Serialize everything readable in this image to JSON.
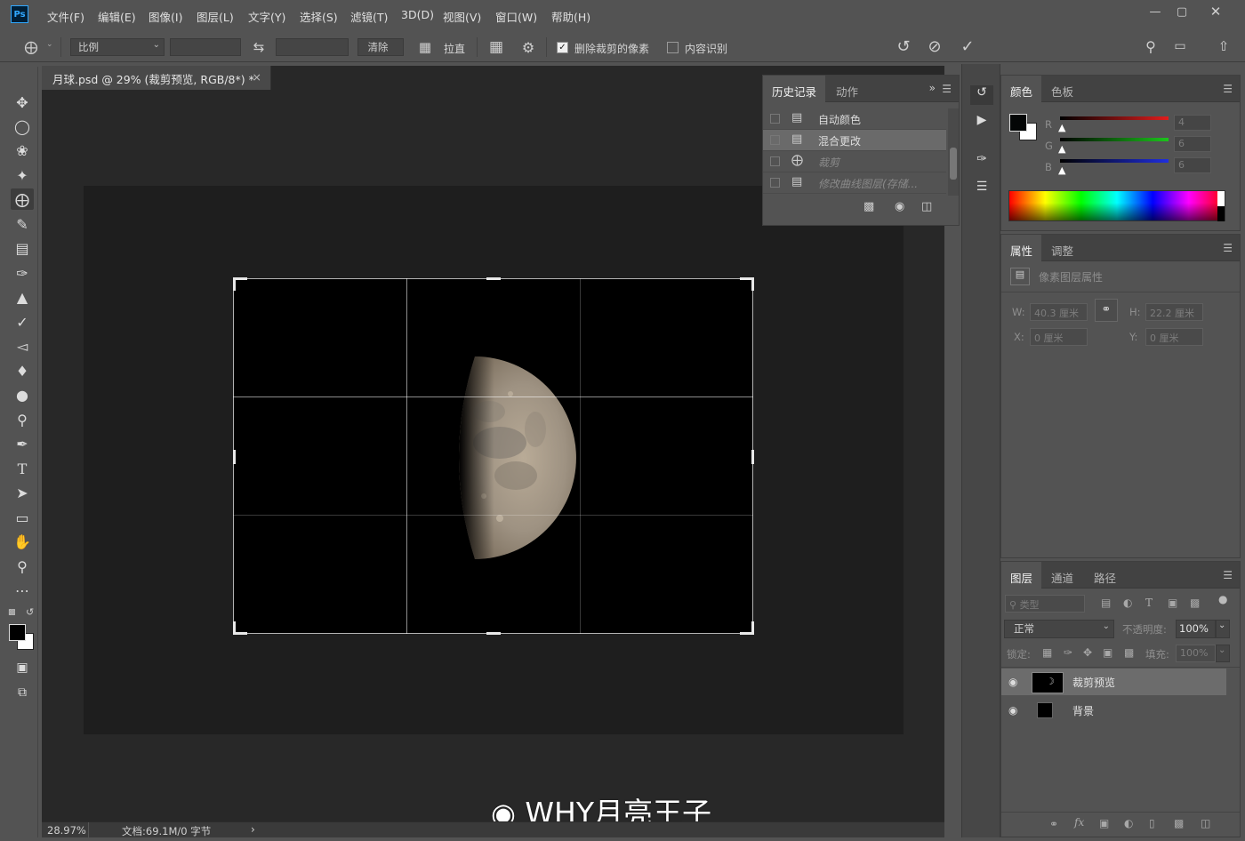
{
  "app": {
    "logo": "Ps"
  },
  "menu": [
    "文件(F)",
    "编辑(E)",
    "图像(I)",
    "图层(L)",
    "文字(Y)",
    "选择(S)",
    "滤镜(T)",
    "3D(D)",
    "视图(V)",
    "窗口(W)",
    "帮助(H)"
  ],
  "window_controls": [
    "minimize-icon",
    "maximize-icon",
    "close-icon"
  ],
  "options": {
    "ratio_label": "比例",
    "clear_label": "清除",
    "straighten_label": "拉直",
    "delete_cropped_label": "删除裁剪的像素",
    "delete_cropped_checked": true,
    "content_aware_label": "内容识别",
    "content_aware_checked": false
  },
  "document": {
    "tab_title": "月球.psd @ 29% (裁剪预览, RGB/8*) *",
    "zoom": "28.97%",
    "doc_info": "文档:69.1M/0 字节"
  },
  "history": {
    "tabs": [
      "历史记录",
      "动作"
    ],
    "items": [
      {
        "label": "自动颜色",
        "icon": "document-icon",
        "selected": false,
        "dimmed": false
      },
      {
        "label": "混合更改",
        "icon": "document-icon",
        "selected": true,
        "dimmed": false
      },
      {
        "label": "裁剪",
        "icon": "crop-icon",
        "selected": false,
        "dimmed": true
      },
      {
        "label": "修改曲线图层(存储...",
        "icon": "document-icon",
        "selected": false,
        "dimmed": true
      }
    ]
  },
  "color_panel": {
    "tabs": [
      "颜色",
      "色板"
    ],
    "channels": [
      {
        "label": "R",
        "value": "4",
        "color": "#e11d1d"
      },
      {
        "label": "G",
        "value": "6",
        "color": "#1cc41c"
      },
      {
        "label": "B",
        "value": "6",
        "color": "#1f2ee0"
      }
    ],
    "foreground": "#040606",
    "background": "#ffffff"
  },
  "properties": {
    "tabs": [
      "属性",
      "调整"
    ],
    "title": "像素图层属性",
    "w_label": "W:",
    "w_value": "40.3 厘米",
    "h_label": "H:",
    "h_value": "22.2 厘米",
    "x_label": "X:",
    "x_value": "0 厘米",
    "y_label": "Y:",
    "y_value": "0 厘米"
  },
  "layers_panel": {
    "tabs": [
      "图层",
      "通道",
      "路径"
    ],
    "filter_placeholder": "类型",
    "blend_mode": "正常",
    "opacity_label": "不透明度:",
    "opacity_value": "100%",
    "lock_label": "锁定:",
    "fill_label": "填充:",
    "fill_value": "100%",
    "layers": [
      {
        "name": "裁剪预览",
        "selected": true
      },
      {
        "name": "背景",
        "selected": false
      }
    ]
  },
  "watermark": "WHY月亮王子"
}
